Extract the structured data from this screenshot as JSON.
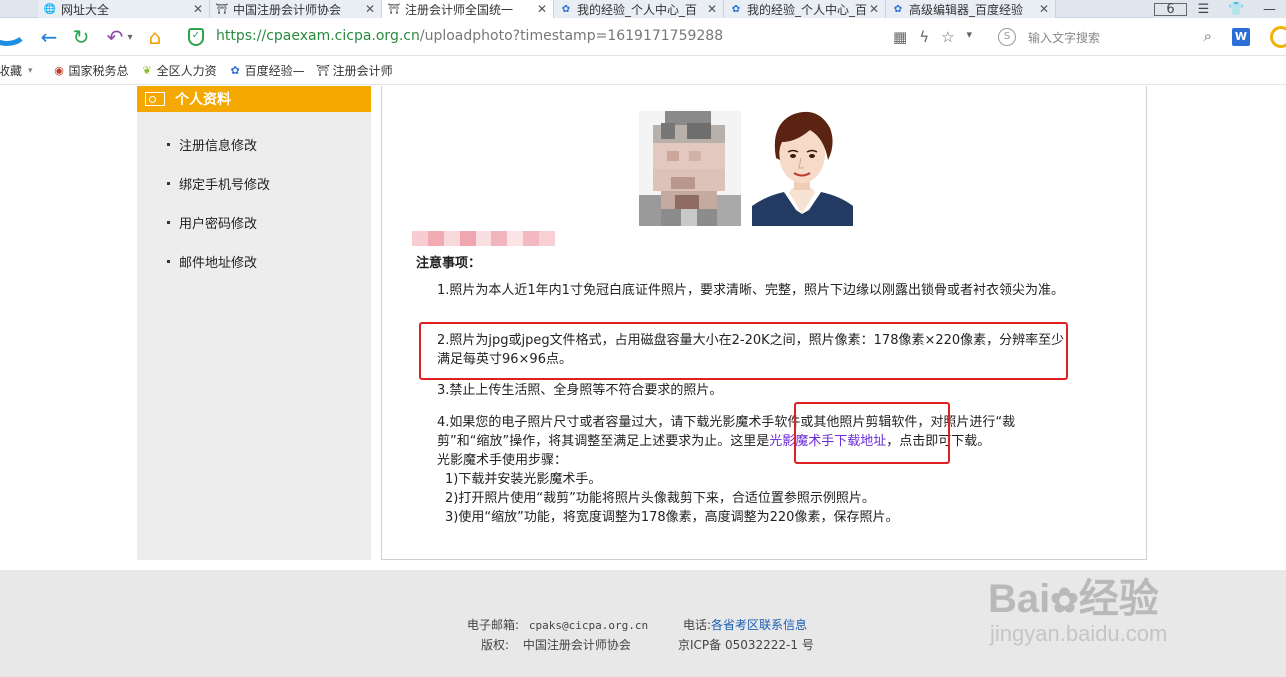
{
  "browser": {
    "tabs": [
      {
        "title": "网址大全",
        "active": false
      },
      {
        "title": "中国注册会计师协会",
        "active": false
      },
      {
        "title": "注册会计师全国统一",
        "active": true
      },
      {
        "title": "我的经验_个人中心_百",
        "active": false
      },
      {
        "title": "我的经验_个人中心_百",
        "active": false
      },
      {
        "title": "高级编辑器_百度经验",
        "active": false
      }
    ],
    "tab_count": "6",
    "url": {
      "scheme": "https://",
      "host": "cpaexam.cicpa.org.cn",
      "path": "/uploadphoto?timestamp=1619171759288"
    },
    "search_placeholder": "输入文字搜索",
    "bookmarks": [
      {
        "label": "收藏",
        "icon": "star-icon"
      },
      {
        "label": "国家税务总",
        "icon": "emblem-icon"
      },
      {
        "label": "全区人力资",
        "icon": "leaf-icon"
      },
      {
        "label": "百度经验—",
        "icon": "baidu-paw-icon"
      },
      {
        "label": "注册会计师",
        "icon": "cicpa-icon"
      }
    ]
  },
  "sidebar": {
    "heading": "个人资料",
    "items": [
      "注册信息修改",
      "绑定手机号修改",
      "用户密码修改",
      "邮件地址修改"
    ]
  },
  "notice": {
    "title": "注意事项：",
    "item1": "1.照片为本人近1年内1寸免冠白底证件照片，要求清晰、完整，照片下边缘以刚露出锁骨或者衬衣领尖为准。",
    "item2": "2.照片为jpg或jpeg文件格式，占用磁盘容量大小在2-20K之间，照片像素：178像素×220像素，分辨率至少满足每英寸96×96点。",
    "item3": "3.禁止上传生活照、全身照等不符合要求的照片。",
    "item4_before": "4.如果您的电子照片尺寸或者容量过大，请下载光影魔术手软件或其他照片剪辑软件，对照片进行“裁剪”和“缩放”操作，将其调整至满足上述要求为止。这里是",
    "item4_link": "光影魔术手下载地址",
    "item4_after": "，点击即可下载。",
    "steps_title": "光影魔术手使用步骤：",
    "steps": [
      "1)下载并安装光影魔术手。",
      "2)打开照片使用“裁剪”功能将照片头像裁剪下来，合适位置参照示例照片。",
      "3)使用“缩放”功能，将宽度调整为178像素，高度调整为220像素，保存照片。"
    ]
  },
  "footer": {
    "email_label": "电子邮箱:",
    "email": "cpaks@cicpa.org.cn",
    "phone_label": "电话:",
    "phone_link": "各省考区联系信息",
    "copyright_label": "版权:",
    "copyright": "中国注册会计师协会",
    "icp": "京ICP备 05032222-1 号"
  },
  "watermark": {
    "brand": "Bai",
    "brand_suffix": "经验",
    "domain": "jingyan.baidu.com"
  },
  "colors": {
    "accent": "#f5a800",
    "link": "#6b2bd6",
    "highlight": "#e02020",
    "url_host": "#2a8a3e"
  }
}
